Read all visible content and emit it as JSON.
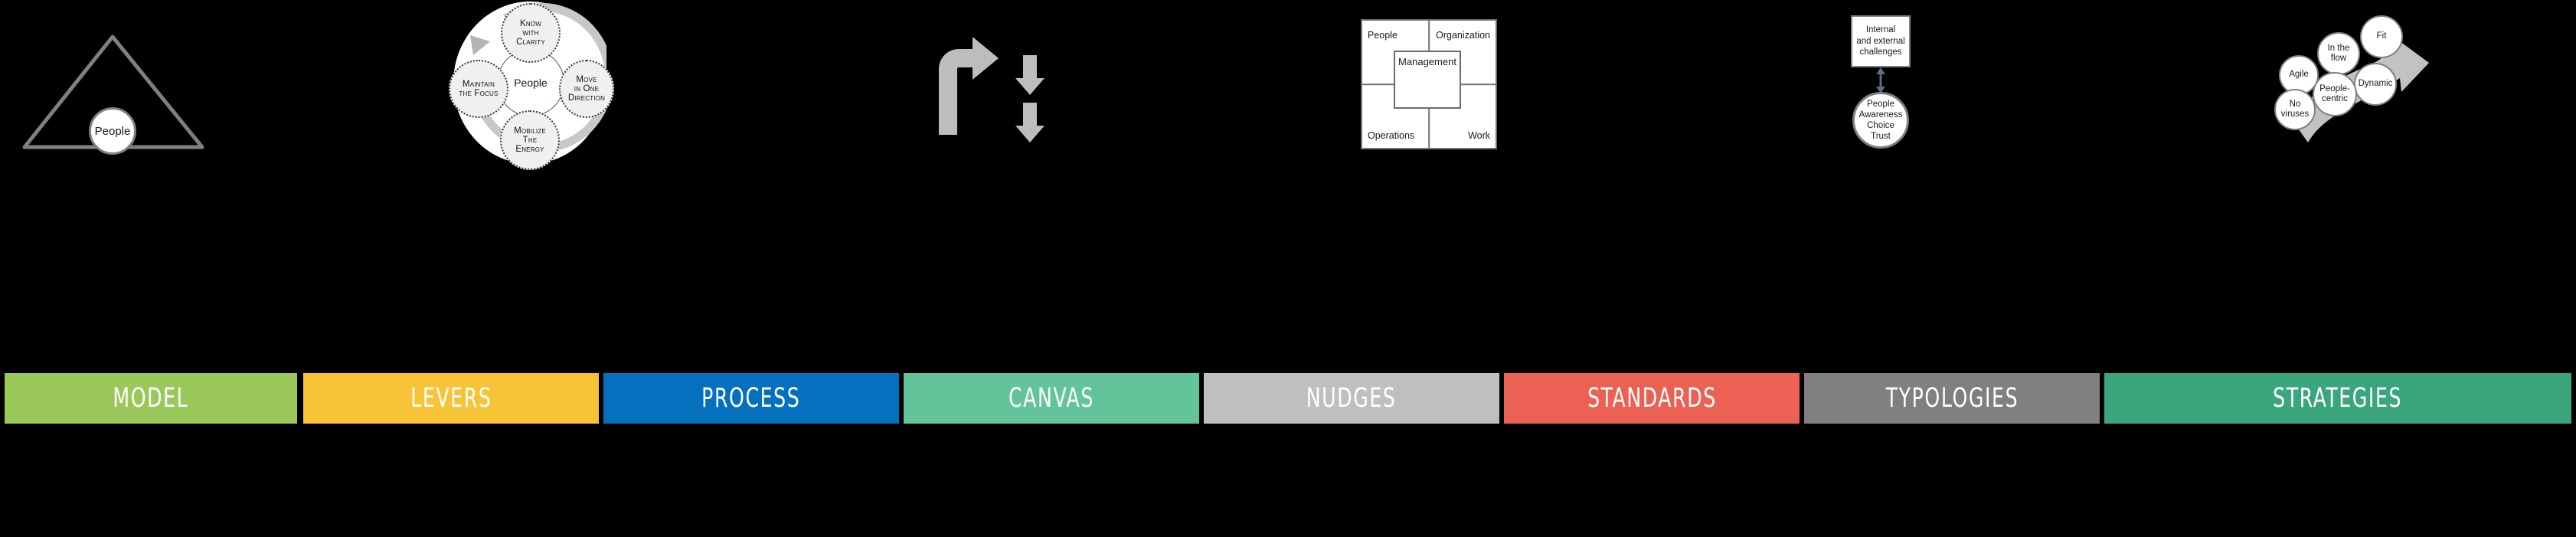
{
  "background_color": "#000000",
  "panels": [
    {
      "key": "model",
      "label": "MODEL",
      "color": "#9BC85A",
      "figure": "triangle-with-people-circle",
      "nodes": [
        {
          "text": "People"
        }
      ]
    },
    {
      "key": "levers",
      "label": "LEVERS",
      "color": "#F7C337",
      "figure": "cycle-wheel-four-levers",
      "center": "People",
      "nodes": [
        {
          "position": "top",
          "lines": [
            "Know",
            "with",
            "Clarity"
          ]
        },
        {
          "position": "right",
          "lines": [
            "Move",
            "in One",
            "Direction"
          ]
        },
        {
          "position": "bottom",
          "lines": [
            "Mobilize",
            "The",
            "Energy"
          ]
        },
        {
          "position": "left",
          "lines": [
            "Maintain",
            "the Focus"
          ]
        }
      ]
    },
    {
      "key": "process",
      "label": "PROCESS",
      "color": "#0571BE",
      "figure": "curved-arrow-and-two-down-arrows",
      "nodes": []
    },
    {
      "key": "canvas",
      "label": "CANVAS",
      "color": "#63C49B",
      "figure": "four-quadrant-matrix",
      "quadrants": {
        "top_left": "People",
        "top_right": "Organization",
        "bottom_left": "Operations",
        "bottom_right": "Work"
      },
      "center": "Management"
    },
    {
      "key": "nudges",
      "label": "NUDGES",
      "color": "#BFBFBF",
      "figure": "box-double-arrow-circle",
      "box_lines": [
        "Internal",
        "and external",
        "challenges"
      ],
      "circle_lines": [
        "People",
        "Awareness",
        "Choice",
        "Trust"
      ]
    },
    {
      "key": "standards",
      "label": "STANDARDS",
      "color": "#EB6153",
      "figure": "cluster-of-bubbles-with-arrow",
      "bubbles": [
        {
          "lines": [
            "Agile"
          ]
        },
        {
          "lines": [
            "In the",
            "flow"
          ]
        },
        {
          "lines": [
            "Fit"
          ]
        },
        {
          "lines": [
            "Dynamic"
          ]
        },
        {
          "lines": [
            "People-",
            "centric"
          ]
        },
        {
          "lines": [
            "No",
            "viruses"
          ]
        }
      ]
    },
    {
      "key": "typologies",
      "label": "TYPOLOGIES",
      "color": "#808080",
      "figure": "grid-of-shaded-rectangles",
      "cells": [
        {
          "row": 1,
          "col": 1,
          "fill": "#F0F0F0"
        },
        {
          "row": 1,
          "col": 2,
          "fill": "#FFFFFF"
        },
        {
          "row": 1,
          "col": 3,
          "fill": "#F0F0F0"
        },
        {
          "row": 2,
          "col": 1,
          "fill": "#A6A6A6"
        },
        {
          "row": 2,
          "col": 3,
          "fill": "#FFFFFF"
        },
        {
          "row": 3,
          "col": 1,
          "fill": "#F0F0F0"
        },
        {
          "row": 3,
          "col": 2,
          "fill": "#A6A6A6"
        },
        {
          "row": 3,
          "col": 3,
          "fill": "#A6A6A6"
        }
      ]
    },
    {
      "key": "strategies",
      "label": "STRATEGIES",
      "color": "#3BA67E",
      "figure": "curved-right-arrow",
      "nodes": []
    }
  ]
}
